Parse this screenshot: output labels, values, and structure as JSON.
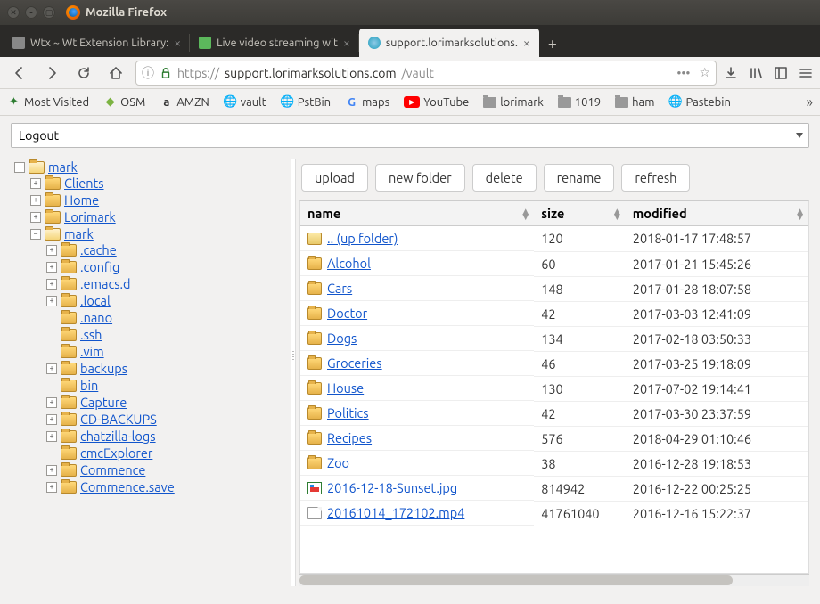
{
  "window": {
    "title": "Mozilla Firefox"
  },
  "tabs": [
    {
      "label": "Wtx ~ Wt Extension Library:",
      "active": false,
      "favicon": "generic"
    },
    {
      "label": "Live video streaming wit",
      "active": false,
      "favicon": "green"
    },
    {
      "label": "support.lorimarksolutions.",
      "active": true,
      "favicon": "globe"
    }
  ],
  "url": {
    "scheme_icon": "info",
    "lock": true,
    "prefix": "https://",
    "host": "support.lorimarksolutions.com",
    "path": "/vault"
  },
  "bookmarks": [
    {
      "label": "Most Visited",
      "icon": "star"
    },
    {
      "label": "OSM",
      "icon": "osm"
    },
    {
      "label": "AMZN",
      "icon": "amzn"
    },
    {
      "label": "vault",
      "icon": "globe"
    },
    {
      "label": "PstBin",
      "icon": "globe"
    },
    {
      "label": "maps",
      "icon": "g"
    },
    {
      "label": "YouTube",
      "icon": "yt"
    },
    {
      "label": "lorimark",
      "icon": "folder"
    },
    {
      "label": "1019",
      "icon": "folder"
    },
    {
      "label": "ham",
      "icon": "folder"
    },
    {
      "label": "Pastebin",
      "icon": "globe"
    }
  ],
  "logout_button": "Logout",
  "tree": {
    "root": {
      "label": "mark",
      "open": true
    },
    "level1": [
      {
        "label": "Clients",
        "expandable": true
      },
      {
        "label": "Home",
        "expandable": true
      },
      {
        "label": "Lorimark",
        "expandable": true
      }
    ],
    "mark_node": {
      "label": "mark",
      "open": true
    },
    "mark_children": [
      {
        "label": ".cache",
        "expandable": true
      },
      {
        "label": ".config",
        "expandable": true
      },
      {
        "label": ".emacs.d",
        "expandable": true
      },
      {
        "label": ".local",
        "expandable": true
      },
      {
        "label": ".nano",
        "expandable": false
      },
      {
        "label": ".ssh",
        "expandable": false
      },
      {
        "label": ".vim",
        "expandable": false
      },
      {
        "label": "backups",
        "expandable": true
      },
      {
        "label": "bin",
        "expandable": false
      },
      {
        "label": "Capture",
        "expandable": true
      },
      {
        "label": "CD-BACKUPS",
        "expandable": true
      },
      {
        "label": "chatzilla-logs",
        "expandable": true
      },
      {
        "label": "cmcExplorer",
        "expandable": false
      },
      {
        "label": "Commence",
        "expandable": true
      },
      {
        "label": "Commence.save",
        "expandable": true
      }
    ]
  },
  "toolbar": {
    "upload": "upload",
    "new_folder": "new folder",
    "delete": "delete",
    "rename": "rename",
    "refresh": "refresh"
  },
  "columns": {
    "name": "name",
    "size": "size",
    "modified": "modified"
  },
  "rows": [
    {
      "icon": "up",
      "name": ".. (up folder)",
      "size": "120",
      "modified": "2018-01-17 17:48:57"
    },
    {
      "icon": "fld",
      "name": "Alcohol",
      "size": "60",
      "modified": "2017-01-21 15:45:26"
    },
    {
      "icon": "fld",
      "name": "Cars",
      "size": "148",
      "modified": "2017-01-28 18:07:58"
    },
    {
      "icon": "fld",
      "name": "Doctor",
      "size": "42",
      "modified": "2017-03-03 12:41:09"
    },
    {
      "icon": "fld",
      "name": "Dogs",
      "size": "134",
      "modified": "2017-02-18 03:50:33"
    },
    {
      "icon": "fld",
      "name": "Groceries",
      "size": "46",
      "modified": "2017-03-25 19:18:09"
    },
    {
      "icon": "fld",
      "name": "House",
      "size": "130",
      "modified": "2017-07-02 19:14:41"
    },
    {
      "icon": "fld",
      "name": "Politics",
      "size": "42",
      "modified": "2017-03-30 23:37:59"
    },
    {
      "icon": "fld",
      "name": "Recipes",
      "size": "576",
      "modified": "2018-04-29 01:10:46"
    },
    {
      "icon": "fld",
      "name": "Zoo",
      "size": "38",
      "modified": "2016-12-28 19:18:53"
    },
    {
      "icon": "img",
      "name": "2016-12-18-Sunset.jpg",
      "size": "814942",
      "modified": "2016-12-22 00:25:25"
    },
    {
      "icon": "file",
      "name": "20161014_172102.mp4",
      "size": "41761040",
      "modified": "2016-12-16 15:22:37"
    }
  ]
}
